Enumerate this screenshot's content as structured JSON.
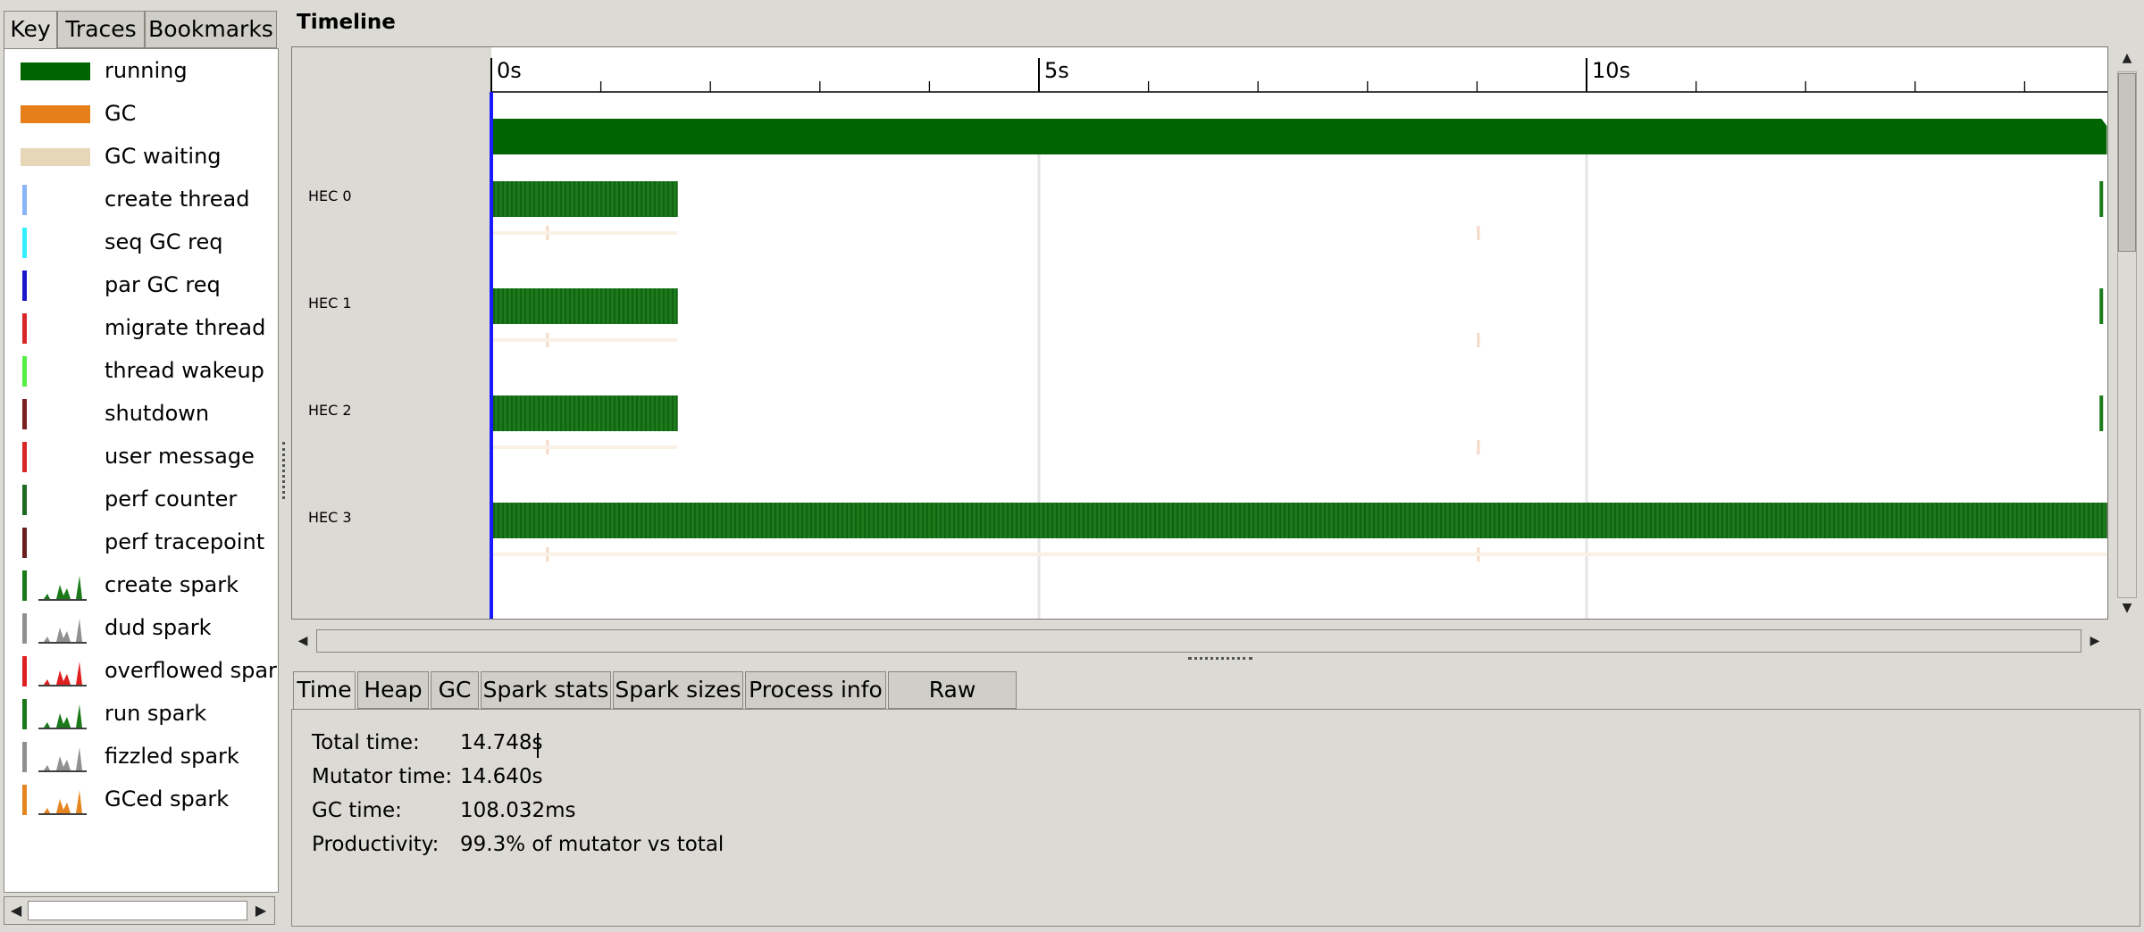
{
  "left_tabs": [
    {
      "label": "Key"
    },
    {
      "label": "Traces"
    },
    {
      "label": "Bookmarks"
    }
  ],
  "key_items": [
    {
      "label": "running",
      "kind": "bar",
      "color": "#006400"
    },
    {
      "label": "GC",
      "kind": "bar",
      "color": "#e67e1a"
    },
    {
      "label": "GC waiting",
      "kind": "bar",
      "color": "#e6d7b8"
    },
    {
      "label": "create thread",
      "kind": "line",
      "color": "#8ab4f8"
    },
    {
      "label": "seq GC req",
      "kind": "line",
      "color": "#33f0ff"
    },
    {
      "label": "par GC req",
      "kind": "line",
      "color": "#1a1acc"
    },
    {
      "label": "migrate thread",
      "kind": "line",
      "color": "#d92626"
    },
    {
      "label": "thread wakeup",
      "kind": "line",
      "color": "#55ee44"
    },
    {
      "label": "shutdown",
      "kind": "line",
      "color": "#7a1f1f"
    },
    {
      "label": "user message",
      "kind": "line",
      "color": "#d92626"
    },
    {
      "label": "perf counter",
      "kind": "line",
      "color": "#1f6b1f"
    },
    {
      "label": "perf tracepoint",
      "kind": "line",
      "color": "#6b1f1f"
    },
    {
      "label": "create spark",
      "kind": "spark",
      "color": "#1a7a1a"
    },
    {
      "label": "dud spark",
      "kind": "spark",
      "color": "#909090"
    },
    {
      "label": "overflowed spark",
      "kind": "spark",
      "color": "#e02020"
    },
    {
      "label": "run spark",
      "kind": "spark",
      "color": "#1a7a1a"
    },
    {
      "label": "fizzled spark",
      "kind": "spark",
      "color": "#909090"
    },
    {
      "label": "GCed spark",
      "kind": "spark",
      "color": "#e6851f"
    }
  ],
  "timeline": {
    "title": "Timeline",
    "axis_labels": [
      "0s",
      "5s",
      "10s"
    ],
    "hecs": [
      {
        "label": "HEC 0",
        "active_until_s": 1.7,
        "resume_at_s": 14.7
      },
      {
        "label": "HEC 1",
        "active_until_s": 1.7,
        "resume_at_s": 14.7
      },
      {
        "label": "HEC 2",
        "active_until_s": 1.7,
        "resume_at_s": 14.7
      },
      {
        "label": "HEC 3",
        "active_until_s": 14.75,
        "resume_at_s": null
      }
    ],
    "total_span_s": 14.75
  },
  "bottom_tabs": [
    {
      "label": "Time"
    },
    {
      "label": "Heap"
    },
    {
      "label": "GC"
    },
    {
      "label": "Spark stats"
    },
    {
      "label": "Spark sizes"
    },
    {
      "label": "Process info"
    },
    {
      "label": "Raw events"
    }
  ],
  "stats": [
    {
      "label": "Total time:",
      "value": "14.748s"
    },
    {
      "label": "Mutator time:",
      "value": "14.640s"
    },
    {
      "label": "GC time:",
      "value": "108.032ms"
    },
    {
      "label": "Productivity:",
      "value": "99.3% of mutator vs total"
    }
  ],
  "colors": {
    "running": "#006400",
    "axis_marker": "#1a1aff",
    "gc_tick": "#f5d9c4"
  }
}
